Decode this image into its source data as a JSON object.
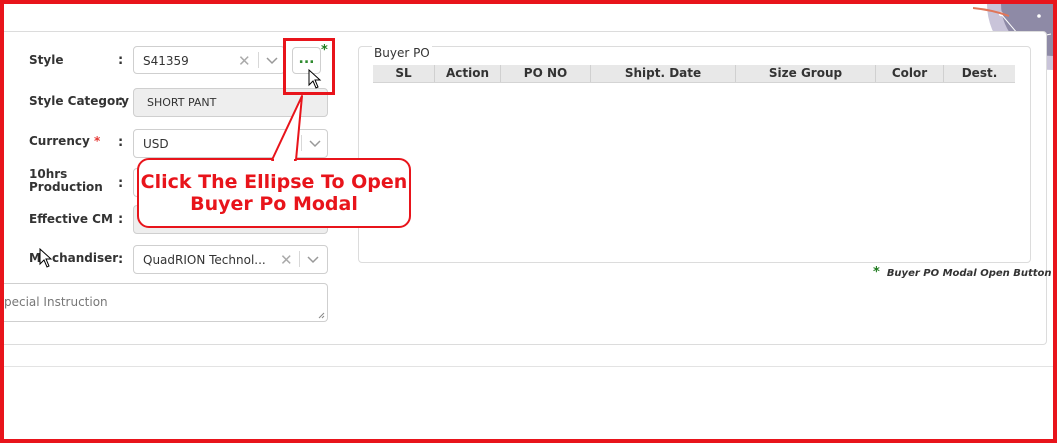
{
  "form": {
    "style": {
      "label": "Style",
      "value": "S41359"
    },
    "style_category": {
      "label": "Style Category",
      "value": "SHORT PANT"
    },
    "currency": {
      "label": "Currency",
      "required_mark": "*",
      "value": "USD"
    },
    "production": {
      "label_line1": "10hrs",
      "label_line2": "Production"
    },
    "effective_cm": {
      "label": "Effective CM"
    },
    "merchandiser": {
      "label_prefix": "M",
      "label_suffix": "chandiser",
      "value": "QuadRION Technol..."
    },
    "special_instruction": {
      "placeholder": "pecial Instruction"
    },
    "colon": ":"
  },
  "ellipsis_button": {
    "label": "...",
    "marker": "*"
  },
  "buyer_po": {
    "title": "Buyer PO",
    "columns": [
      "SL",
      "Action",
      "PO NO",
      "Shipt. Date",
      "Size Group",
      "Color",
      "Dest."
    ]
  },
  "note": {
    "marker": "*",
    "text": "Buyer PO Modal Open Button"
  },
  "callout": {
    "line1": "Click The Ellipse To Open",
    "line2": "Buyer Po Modal"
  },
  "colors": {
    "annotation": "#e8141b",
    "accent_green": "#2e8b2e"
  }
}
